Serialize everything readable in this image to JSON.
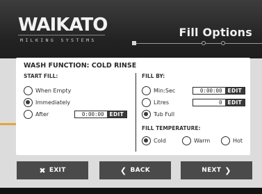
{
  "header": {
    "logo_main": "WAIKATO",
    "logo_sub": "MILKING SYSTEMS",
    "title": "Fill Options"
  },
  "panel": {
    "title": "WASH FUNCTION: COLD RINSE",
    "start_fill": {
      "heading": "START FILL:",
      "options": [
        {
          "label": "When Empty",
          "selected": false
        },
        {
          "label": "Immediately",
          "selected": true
        },
        {
          "label": "After",
          "selected": false
        }
      ],
      "after_time": "0:00:00",
      "after_edit": "EDIT"
    },
    "fill_by": {
      "heading": "FILL BY:",
      "options": [
        {
          "label": "Min:Sec",
          "selected": false
        },
        {
          "label": "Litres",
          "selected": false
        },
        {
          "label": "Tub Full",
          "selected": true
        }
      ],
      "minsec_value": "0:00:00",
      "minsec_edit": "EDIT",
      "litres_value": "0",
      "litres_edit": "EDIT"
    },
    "fill_temperature": {
      "heading": "FILL TEMPERATURE:",
      "options": [
        {
          "label": "Cold",
          "selected": true
        },
        {
          "label": "Warm",
          "selected": false
        },
        {
          "label": "Hot",
          "selected": false
        }
      ]
    }
  },
  "buttons": {
    "exit": "EXIT",
    "back": "BACK",
    "next": "NEXT"
  },
  "icons": {
    "exit": "close-x-icon",
    "back": "chevron-left-icon",
    "next": "chevron-right-icon"
  },
  "colors": {
    "header_bg": "#222222",
    "button_bg": "#4a4a4a",
    "selected_radio": "#3a3a3a"
  }
}
